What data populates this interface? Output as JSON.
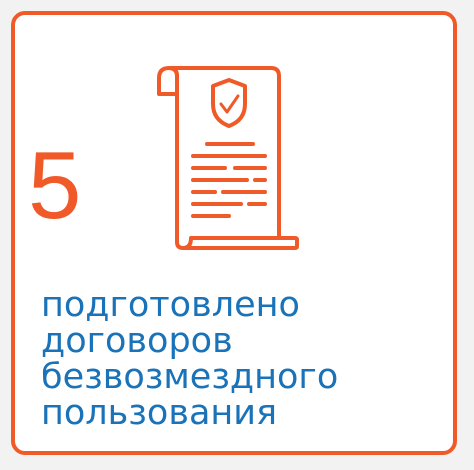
{
  "stat": {
    "value": "5",
    "caption_lines": [
      "подготовлено",
      "договоров",
      "безвозмездного",
      "пользования"
    ]
  },
  "icons": {
    "document": "contract-scroll-icon",
    "shield": "shield-icon"
  },
  "colors": {
    "accent": "#f05a28",
    "text": "#1a73b8",
    "background": "#f2f2f2",
    "card": "#ffffff"
  }
}
